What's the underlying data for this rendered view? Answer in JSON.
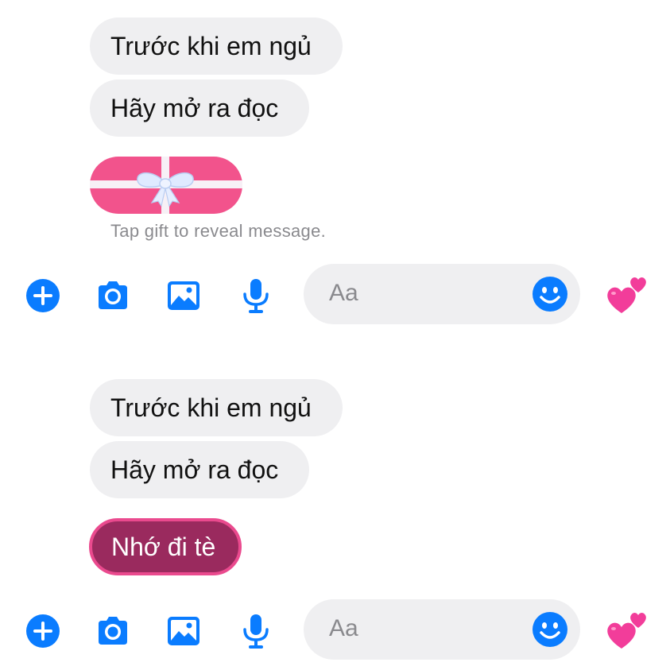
{
  "colors": {
    "accent": "#0a7cff",
    "bubble_bg": "#efeff1",
    "gift_pink": "#f2538c",
    "revealed_bubble": "#9a2a5e",
    "revealed_border": "#ea4a8e"
  },
  "top_panel": {
    "messages": [
      {
        "text": "Trước khi em ngủ"
      },
      {
        "text": "Hãy mở ra đọc"
      }
    ],
    "gift": {
      "icon": "gift-ribbon-icon",
      "caption": "Tap gift to reveal message."
    },
    "composer": {
      "placeholder": "Aa",
      "icons": [
        "plus-icon",
        "camera-icon",
        "image-icon",
        "microphone-icon",
        "emoji-icon",
        "hearts-icon"
      ]
    }
  },
  "bottom_panel": {
    "messages": [
      {
        "text": "Trước khi em ngủ"
      },
      {
        "text": "Hãy mở ra đọc"
      }
    ],
    "revealed_message": "Nhớ đi tè",
    "composer": {
      "placeholder": "Aa",
      "icons": [
        "plus-icon",
        "camera-icon",
        "image-icon",
        "microphone-icon",
        "emoji-icon",
        "hearts-icon"
      ]
    }
  }
}
